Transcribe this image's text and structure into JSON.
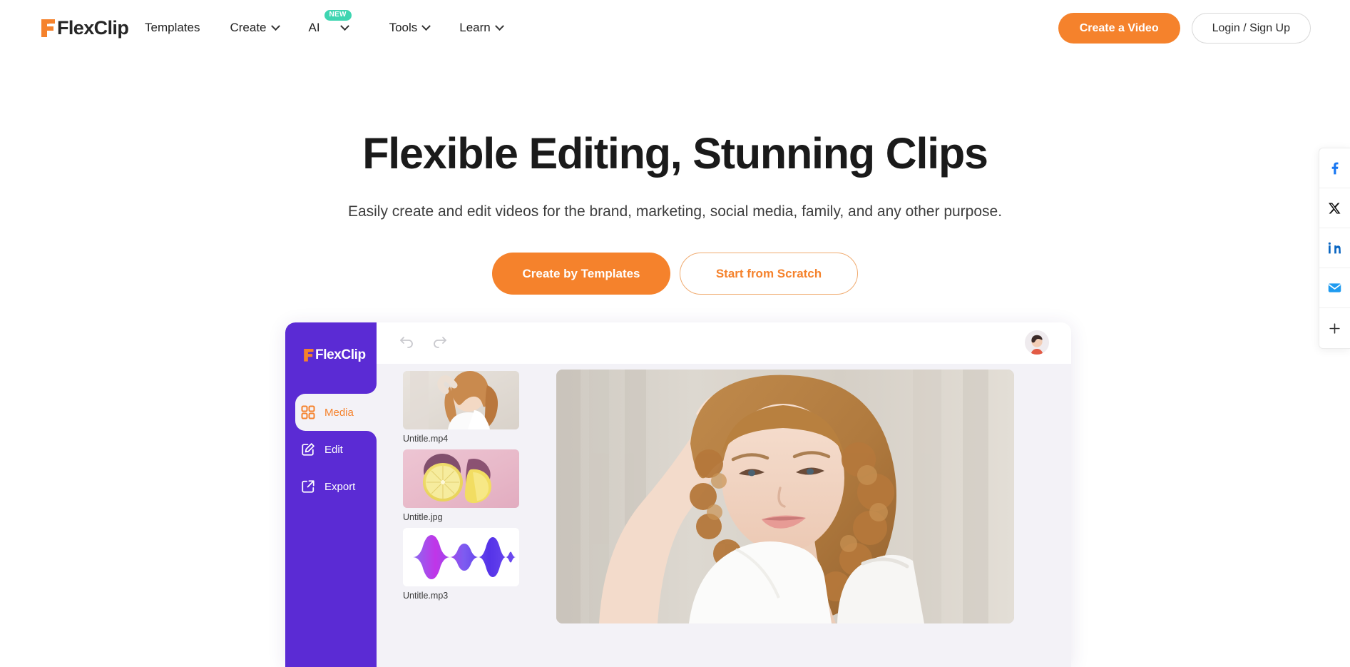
{
  "brand": {
    "name": "FlexClip",
    "logo_mark": "flexclip-f-icon",
    "accent_orange": "#f5822c",
    "accent_purple": "#5b2bd4",
    "badge_teal": "#3ed5b1"
  },
  "header": {
    "nav_items": [
      {
        "label": "Templates",
        "has_caret": false,
        "badge": null
      },
      {
        "label": "Create",
        "has_caret": true,
        "badge": null
      },
      {
        "label": "AI",
        "has_caret": true,
        "badge": "NEW"
      },
      {
        "label": "Tools",
        "has_caret": true,
        "badge": null
      },
      {
        "label": "Learn",
        "has_caret": true,
        "badge": null
      }
    ],
    "create_video_label": "Create a Video",
    "login_label": "Login / Sign Up"
  },
  "hero": {
    "title": "Flexible Editing, Stunning Clips",
    "subtitle": "Easily create and edit videos for the brand, marketing, social media, family, and any other purpose.",
    "primary_cta": "Create by Templates",
    "secondary_cta": "Start from Scratch"
  },
  "mockup": {
    "logo_name": "FlexClip",
    "undo_icon": "undo-arrow-icon",
    "redo_icon": "redo-arrow-icon",
    "avatar_icon": "user-avatar",
    "sidebar_items": [
      {
        "label": "Media",
        "icon": "grid-squares-icon",
        "active": true
      },
      {
        "label": "Edit",
        "icon": "pencil-square-icon",
        "active": false
      },
      {
        "label": "Export",
        "icon": "export-arrow-icon",
        "active": false
      }
    ],
    "media_files": [
      {
        "label": "Untitle.mp4",
        "kind": "video-thumbnail"
      },
      {
        "label": "Untitle.jpg",
        "kind": "image-thumbnail"
      },
      {
        "label": "Untitle.mp3",
        "kind": "audio-waveform"
      }
    ],
    "preview_alt": "video-preview-frame"
  },
  "social_rail": {
    "items": [
      {
        "name": "facebook-icon",
        "label": "f"
      },
      {
        "name": "x-twitter-icon",
        "label": "X"
      },
      {
        "name": "linkedin-icon",
        "label": "in"
      },
      {
        "name": "email-icon",
        "label": "envelope"
      },
      {
        "name": "plus-more-icon",
        "label": "+"
      }
    ]
  }
}
